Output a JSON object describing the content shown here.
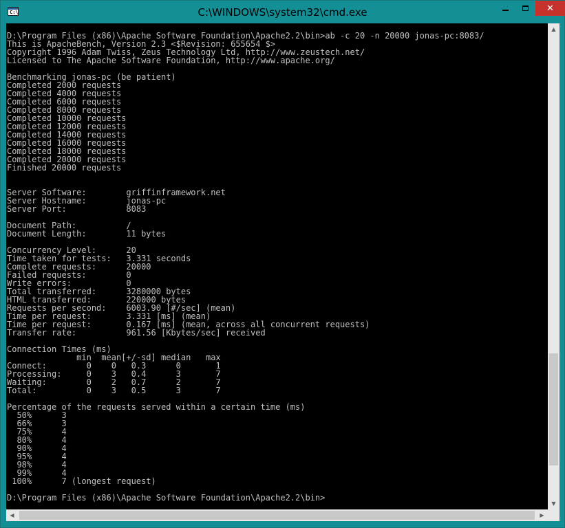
{
  "window": {
    "title": "C:\\WINDOWS\\system32\\cmd.exe",
    "icon_text": "C:\\",
    "close_glyph": "✕"
  },
  "console": {
    "lines": [
      "D:\\Program Files (x86)\\Apache Software Foundation\\Apache2.2\\bin>ab -c 20 -n 20000 jonas-pc:8083/",
      "This is ApacheBench, Version 2.3 <$Revision: 655654 $>",
      "Copyright 1996 Adam Twiss, Zeus Technology Ltd, http://www.zeustech.net/",
      "Licensed to The Apache Software Foundation, http://www.apache.org/",
      "",
      "Benchmarking jonas-pc (be patient)",
      "Completed 2000 requests",
      "Completed 4000 requests",
      "Completed 6000 requests",
      "Completed 8000 requests",
      "Completed 10000 requests",
      "Completed 12000 requests",
      "Completed 14000 requests",
      "Completed 16000 requests",
      "Completed 18000 requests",
      "Completed 20000 requests",
      "Finished 20000 requests",
      "",
      "",
      "Server Software:        griffinframework.net",
      "Server Hostname:        jonas-pc",
      "Server Port:            8083",
      "",
      "Document Path:          /",
      "Document Length:        11 bytes",
      "",
      "Concurrency Level:      20",
      "Time taken for tests:   3.331 seconds",
      "Complete requests:      20000",
      "Failed requests:        0",
      "Write errors:           0",
      "Total transferred:      3280000 bytes",
      "HTML transferred:       220000 bytes",
      "Requests per second:    6003.90 [#/sec] (mean)",
      "Time per request:       3.331 [ms] (mean)",
      "Time per request:       0.167 [ms] (mean, across all concurrent requests)",
      "Transfer rate:          961.56 [Kbytes/sec] received",
      "",
      "Connection Times (ms)",
      "              min  mean[+/-sd] median   max",
      "Connect:        0    0   0.3      0       1",
      "Processing:     0    3   0.4      3       7",
      "Waiting:        0    2   0.7      2       7",
      "Total:          0    3   0.5      3       7",
      "",
      "Percentage of the requests served within a certain time (ms)",
      "  50%      3",
      "  66%      3",
      "  75%      4",
      "  80%      4",
      "  90%      4",
      "  95%      4",
      "  98%      4",
      "  99%      4",
      " 100%      7 (longest request)",
      "",
      "D:\\Program Files (x86)\\Apache Software Foundation\\Apache2.2\\bin>"
    ]
  },
  "icons": {
    "scroll_up": "▲",
    "scroll_down": "▼",
    "scroll_left": "◀",
    "scroll_right": "▶"
  },
  "colors": {
    "titlebar": "#138f95",
    "close_button": "#c7322c",
    "console_bg": "#000000",
    "console_text": "#c0c0c0"
  }
}
